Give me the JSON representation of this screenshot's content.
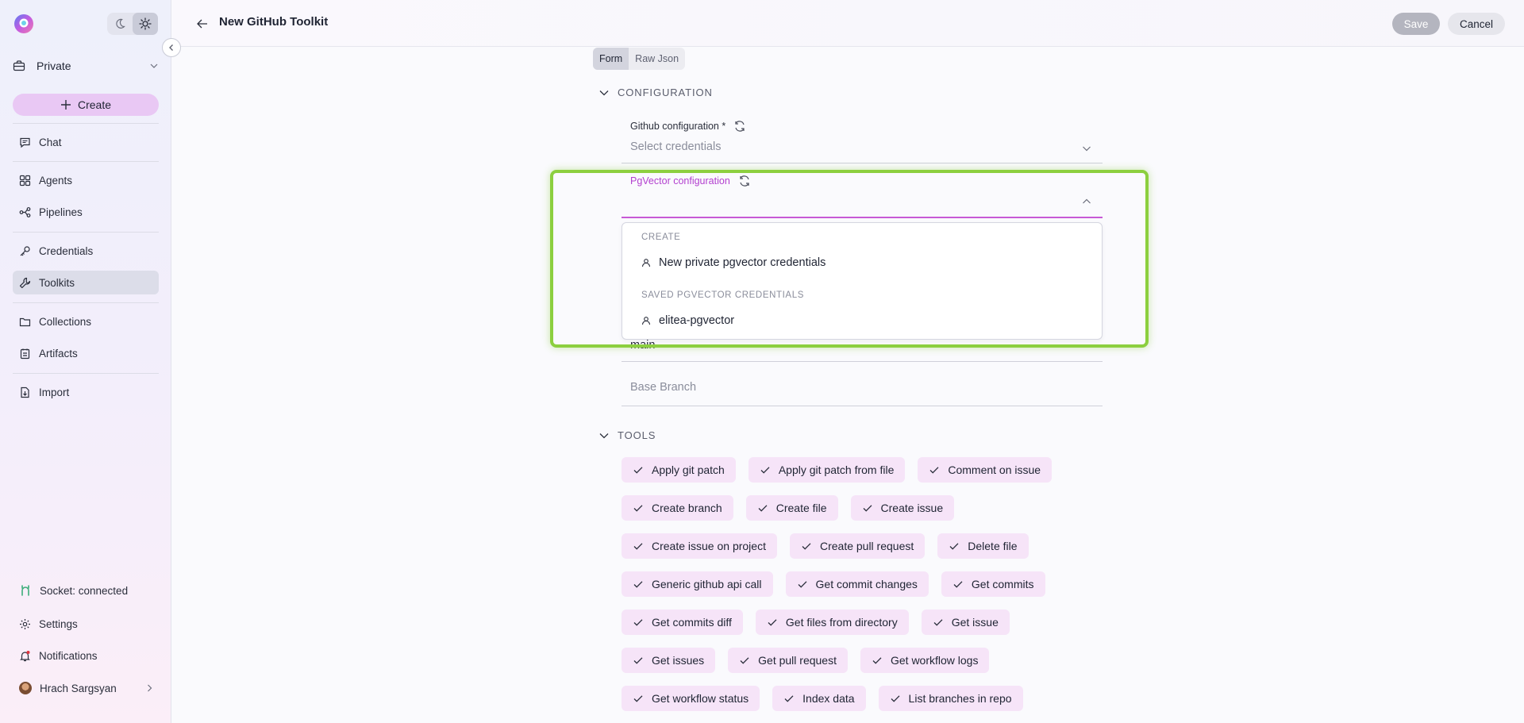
{
  "app": {
    "project": "Private",
    "create_label": "Create",
    "nav": {
      "chat": "Chat",
      "agents": "Agents",
      "pipelines": "Pipelines",
      "credentials": "Credentials",
      "toolkits": "Toolkits",
      "collections": "Collections",
      "artifacts": "Artifacts",
      "import": "Import"
    },
    "footer": {
      "socket": "Socket: connected",
      "settings": "Settings",
      "notifications": "Notifications",
      "user": "Hrach Sargsyan"
    }
  },
  "header": {
    "title": "New GitHub Toolkit",
    "save_label": "Save",
    "cancel_label": "Cancel"
  },
  "view_tabs": [
    "Form",
    "Raw Json"
  ],
  "configuration": {
    "title": "CONFIGURATION",
    "github_label": "Github configuration *",
    "github_placeholder": "Select credentials",
    "pgvector_label": "PgVector configuration",
    "dropdown": {
      "create_group": "CREATE",
      "create_item": "New private pgvector credentials",
      "saved_group": "SAVED PGVECTOR CREDENTIALS",
      "saved_item": "elitea-pgvector"
    },
    "active_branch_value": "main",
    "base_branch_placeholder": "Base Branch"
  },
  "tools": {
    "title": "TOOLS",
    "rows": [
      [
        "Apply git patch",
        "Apply git patch from file",
        "Comment on issue"
      ],
      [
        "Create branch",
        "Create file",
        "Create issue"
      ],
      [
        "Create issue on project",
        "Create pull request",
        "Delete file"
      ],
      [
        "Generic github api call",
        "Get commit changes",
        "Get commits"
      ],
      [
        "Get commits diff",
        "Get files from directory",
        "Get issue"
      ],
      [
        "Get issues",
        "Get pull request",
        "Get workflow logs"
      ],
      [
        "Get workflow status",
        "Index data",
        "List branches in repo"
      ]
    ]
  },
  "colors": {
    "accent": "#c75ad6",
    "highlight": "#8ccf3f",
    "chip_bg": "#f6e4f8"
  }
}
